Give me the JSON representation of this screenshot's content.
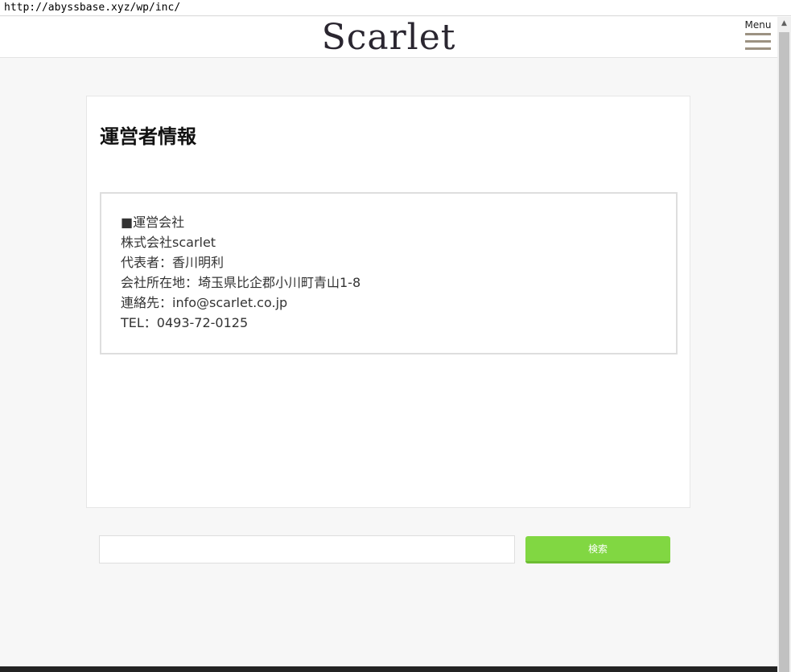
{
  "browser": {
    "url": "http://abyssbase.xyz/wp/inc/"
  },
  "header": {
    "logo": "Scarlet",
    "menu_label": "Menu"
  },
  "page": {
    "title": "運営者情報",
    "info_lines": [
      "■運営会社",
      "株式会社scarlet",
      "代表者：香川明利",
      "会社所在地：埼玉県比企郡小川町青山1-8",
      "連絡先：info@scarlet.co.jp",
      "TEL：0493-72-0125"
    ]
  },
  "search": {
    "value": "",
    "button_label": "検索"
  },
  "colors": {
    "accent_green": "#81d742",
    "menu_bars": "#9c9282",
    "footer": "#232323"
  }
}
